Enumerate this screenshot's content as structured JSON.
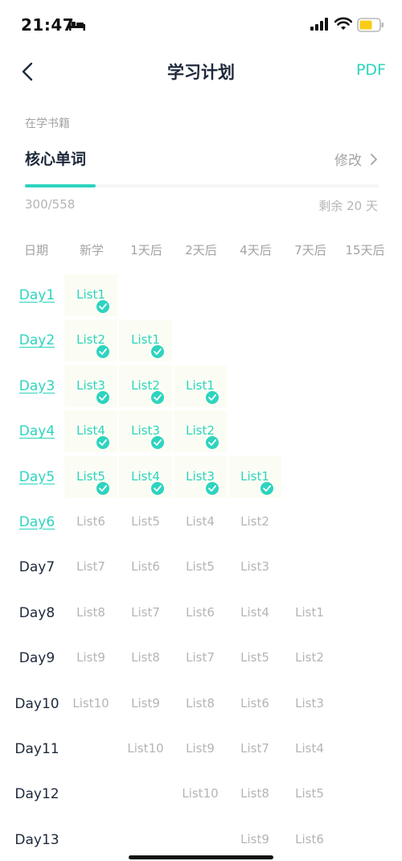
{
  "status_bar": {
    "time": "21:47"
  },
  "nav": {
    "title": "学习计划",
    "pdf_label": "PDF"
  },
  "book": {
    "caption": "在学书籍",
    "name": "核心单词",
    "modify_label": "修改",
    "progress_text": "300/558",
    "progress_fraction": 0.2,
    "remaining_text": "剩余 20 天"
  },
  "colors": {
    "accent": "#2dd4bf",
    "muted": "#b5b5b5",
    "done_cell_bg": "#fbfdf4"
  },
  "schedule": {
    "headers": [
      "日期",
      "新学",
      "1天后",
      "2天后",
      "4天后",
      "7天后",
      "15天后"
    ],
    "rows": [
      {
        "day": "Day1",
        "done": true,
        "cells": [
          "List1",
          "",
          "",
          "",
          "",
          ""
        ]
      },
      {
        "day": "Day2",
        "done": true,
        "cells": [
          "List2",
          "List1",
          "",
          "",
          "",
          ""
        ]
      },
      {
        "day": "Day3",
        "done": true,
        "cells": [
          "List3",
          "List2",
          "List1",
          "",
          "",
          ""
        ]
      },
      {
        "day": "Day4",
        "done": true,
        "cells": [
          "List4",
          "List3",
          "List2",
          "",
          "",
          ""
        ]
      },
      {
        "day": "Day5",
        "done": true,
        "cells": [
          "List5",
          "List4",
          "List3",
          "List1",
          "",
          ""
        ]
      },
      {
        "day": "Day6",
        "done": false,
        "link": true,
        "cells": [
          "List6",
          "List5",
          "List4",
          "List2",
          "",
          ""
        ]
      },
      {
        "day": "Day7",
        "done": false,
        "cells": [
          "List7",
          "List6",
          "List5",
          "List3",
          "",
          ""
        ]
      },
      {
        "day": "Day8",
        "done": false,
        "cells": [
          "List8",
          "List7",
          "List6",
          "List4",
          "List1",
          ""
        ]
      },
      {
        "day": "Day9",
        "done": false,
        "cells": [
          "List9",
          "List8",
          "List7",
          "List5",
          "List2",
          ""
        ]
      },
      {
        "day": "Day10",
        "done": false,
        "cells": [
          "List10",
          "List9",
          "List8",
          "List6",
          "List3",
          ""
        ]
      },
      {
        "day": "Day11",
        "done": false,
        "cells": [
          "",
          "List10",
          "List9",
          "List7",
          "List4",
          ""
        ]
      },
      {
        "day": "Day12",
        "done": false,
        "cells": [
          "",
          "",
          "List10",
          "List8",
          "List5",
          ""
        ]
      },
      {
        "day": "Day13",
        "done": false,
        "cells": [
          "",
          "",
          "",
          "List9",
          "List6",
          ""
        ]
      }
    ]
  }
}
